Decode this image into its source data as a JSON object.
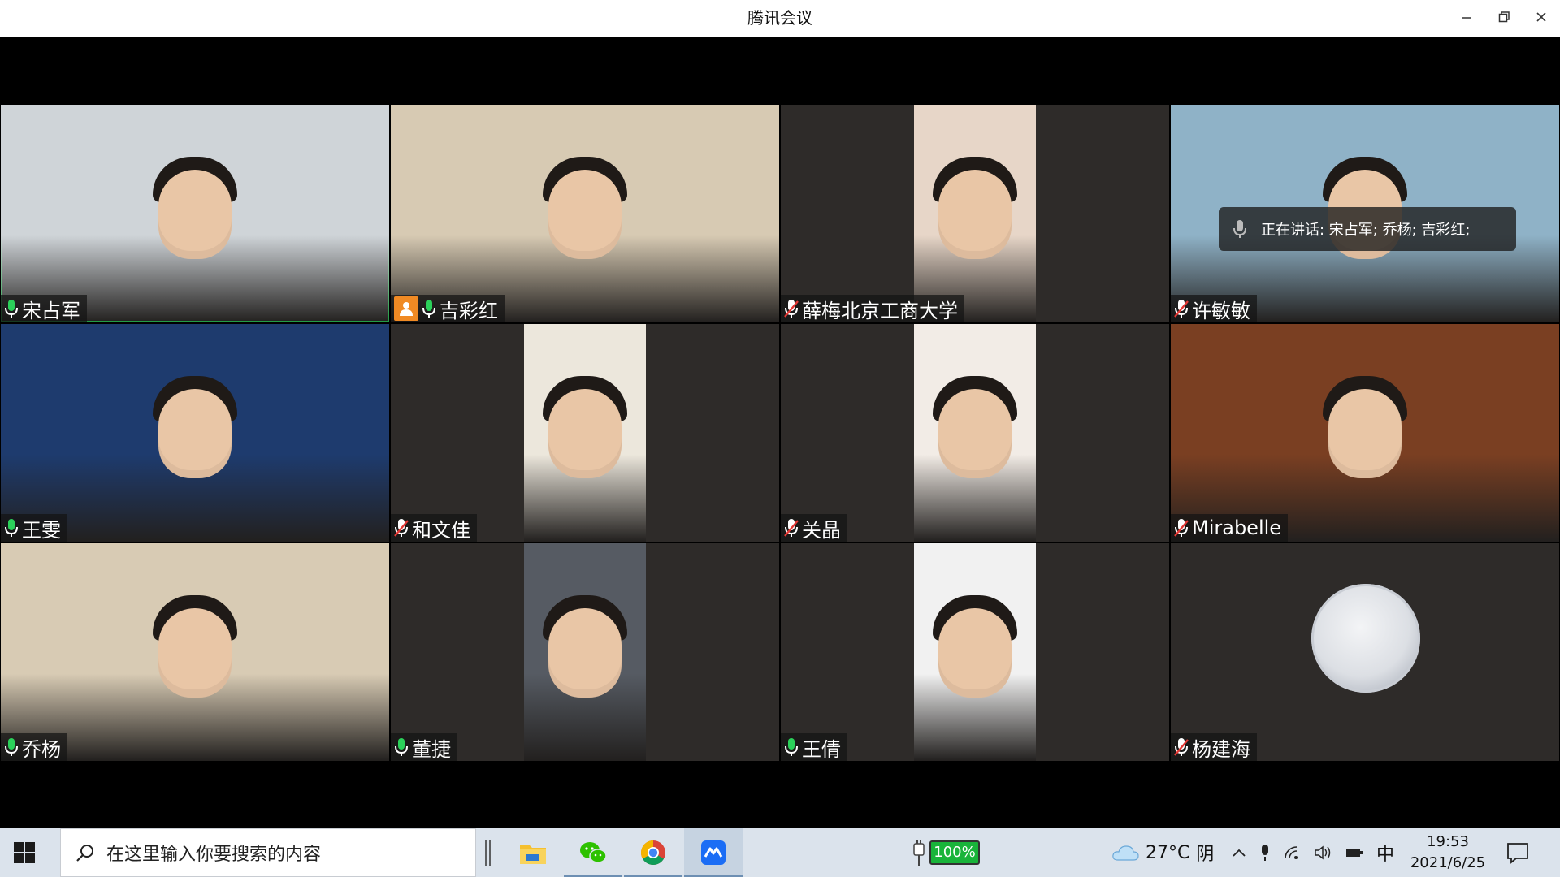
{
  "window": {
    "title": "腾讯会议",
    "minimize_icon": "minimize-icon",
    "restore_icon": "restore-icon",
    "close_icon": "close-icon"
  },
  "speaking_toast": {
    "text": "正在讲话: 宋占军; 乔杨; 吉彩红;"
  },
  "participants": [
    {
      "name": "宋占军",
      "mic": "on",
      "host": false,
      "active": true,
      "layout": "full",
      "bg": "#cfd4d8"
    },
    {
      "name": "吉彩红",
      "mic": "on",
      "host": true,
      "active": false,
      "layout": "full",
      "bg": "#d7cab3"
    },
    {
      "name": "薛梅北京工商大学",
      "mic": "muted",
      "host": false,
      "active": false,
      "layout": "portrait",
      "bg": "#e7d6c8"
    },
    {
      "name": "许敏敏",
      "mic": "muted",
      "host": false,
      "active": false,
      "layout": "full",
      "bg": "#8fb2c7"
    },
    {
      "name": "王雯",
      "mic": "on",
      "host": false,
      "active": false,
      "layout": "full",
      "bg": "#1e3b6e"
    },
    {
      "name": "和文佳",
      "mic": "muted",
      "host": false,
      "active": false,
      "layout": "portrait",
      "bg": "#ece7dc"
    },
    {
      "name": "关晶",
      "mic": "muted",
      "host": false,
      "active": false,
      "layout": "portrait",
      "bg": "#f2ece6"
    },
    {
      "name": "Mirabelle",
      "mic": "muted",
      "host": false,
      "active": false,
      "layout": "full",
      "bg": "#7a3f22"
    },
    {
      "name": "乔杨",
      "mic": "on",
      "host": false,
      "active": false,
      "layout": "full",
      "bg": "#d8cbb4"
    },
    {
      "name": "董捷",
      "mic": "on",
      "host": false,
      "active": false,
      "layout": "portrait",
      "bg": "#565b63"
    },
    {
      "name": "王倩",
      "mic": "on",
      "host": false,
      "active": false,
      "layout": "portrait",
      "bg": "#f1f1f1"
    },
    {
      "name": "杨建海",
      "mic": "muted",
      "host": false,
      "active": false,
      "layout": "avatar",
      "bg": "#2e2b29"
    }
  ],
  "taskbar": {
    "search_placeholder": "在这里输入你要搜索的内容",
    "battery_percent": "100%",
    "weather_temp": "27°C",
    "weather_desc": "阴",
    "ime": "中",
    "time": "19:53",
    "date": "2021/6/25"
  },
  "colors": {
    "active_border": "#2bd15a",
    "host_badge": "#f08a24",
    "battery_fill": "#19b43a",
    "taskbar_bg": "#dbe3ec"
  }
}
